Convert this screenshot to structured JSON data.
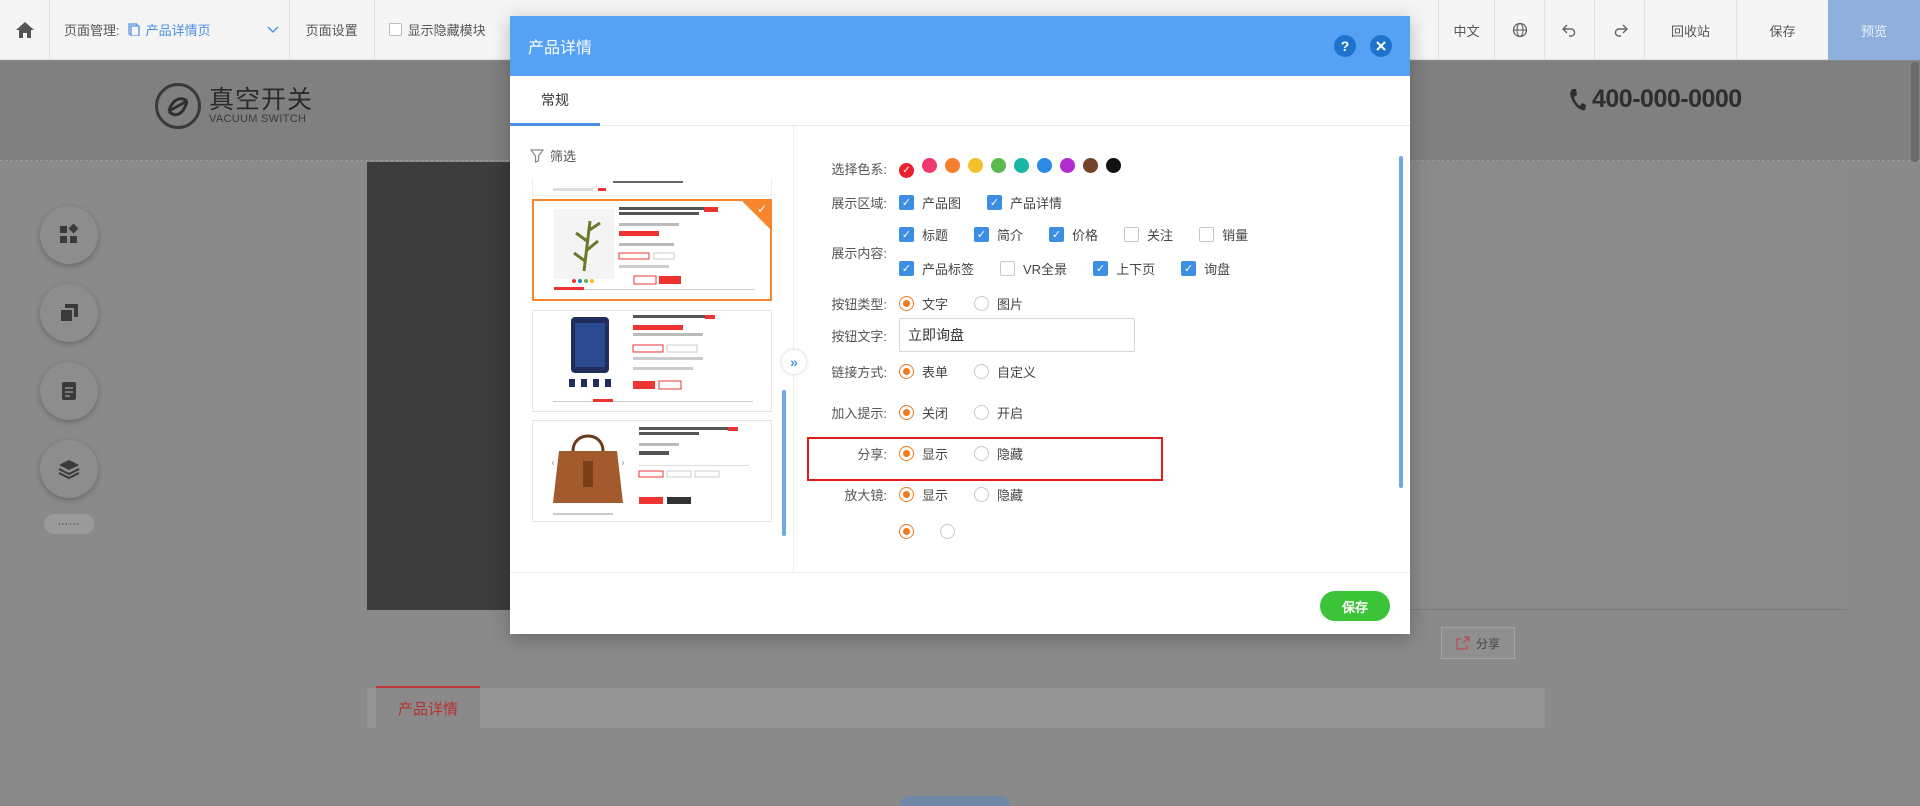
{
  "topbar": {
    "page_mgmt_label": "页面管理:",
    "current_page": "产品详情页",
    "page_settings": "页面设置",
    "show_hidden": "显示隐藏模块",
    "lang": "中文",
    "recycle": "回收站",
    "save": "保存",
    "preview": "预览"
  },
  "site": {
    "logo_cn": "真空开关",
    "logo_en": "VACUUM SWITCH",
    "phone": "400-000-0000",
    "share": "分享",
    "detail_tab": "产品详情",
    "side_dots": "⋯⋯"
  },
  "modal": {
    "title": "产品详情",
    "help": "?",
    "tab_general": "常规",
    "filter": "筛选",
    "expand": "»",
    "save": "保存",
    "labels": {
      "color": "选择色系:",
      "display_area": "展示区域:",
      "display_content": "展示内容:",
      "button_type": "按钮类型:",
      "button_text": "按钮文字:",
      "link_mode": "链接方式:",
      "join_tip": "加入提示:",
      "share": "分享:",
      "magnifier": "放大镜:"
    },
    "display_area": [
      {
        "label": "产品图",
        "checked": true
      },
      {
        "label": "产品详情",
        "checked": true
      }
    ],
    "display_content_row1": [
      {
        "label": "标题",
        "checked": true
      },
      {
        "label": "简介",
        "checked": true
      },
      {
        "label": "价格",
        "checked": true
      },
      {
        "label": "关注",
        "checked": false
      },
      {
        "label": "销量",
        "checked": false
      }
    ],
    "display_content_row2": [
      {
        "label": "产品标签",
        "checked": true
      },
      {
        "label": "VR全景",
        "checked": false
      },
      {
        "label": "上下页",
        "checked": true
      },
      {
        "label": "询盘",
        "checked": true
      }
    ],
    "button_type": [
      "文字",
      "图片"
    ],
    "button_text_value": "立即询盘",
    "link_mode": [
      "表单",
      "自定义"
    ],
    "join_tip": [
      "关闭",
      "开启"
    ],
    "share": [
      "显示",
      "隐藏"
    ],
    "magnifier": [
      "显示",
      "隐藏"
    ],
    "colors": [
      "#e8202f",
      "#f0386e",
      "#f77e2c",
      "#f5c12b",
      "#5ab94c",
      "#15b6a3",
      "#2a8ae8",
      "#b22bcd",
      "#73432a",
      "#111111"
    ]
  }
}
